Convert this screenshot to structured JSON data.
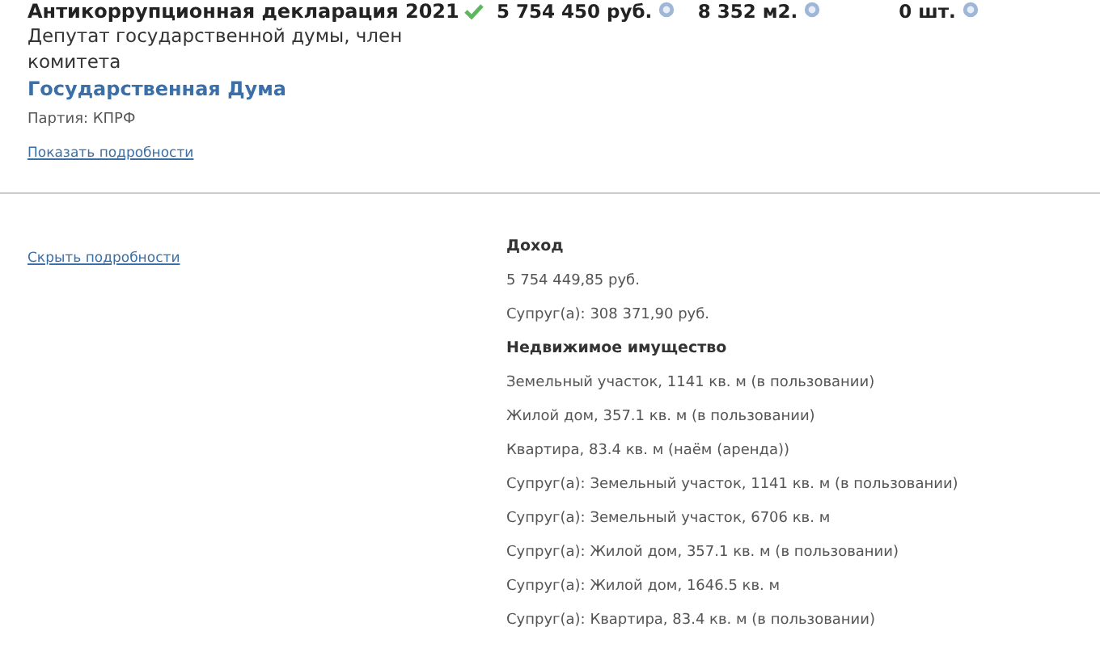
{
  "declaration": {
    "title": "Антикоррупционная декларация 2021",
    "verified": true,
    "position": "Депутат государственной думы, член комитета",
    "organization": "Государственная Дума",
    "party": "Партия: КПРФ",
    "show_details_link": "Показать подробности"
  },
  "stats": [
    {
      "value": "5 754 450 руб."
    },
    {
      "value": "8 352 м2."
    },
    {
      "value": "0 шт."
    }
  ],
  "details": {
    "hide_details_link": "Скрыть подробности",
    "sections": [
      {
        "heading": "Доход",
        "items": [
          "5 754 449,85 руб.",
          "Супруг(а): 308 371,90 руб."
        ]
      },
      {
        "heading": "Недвижимое имущество",
        "items": [
          "Земельный участок, 1141 кв. м (в пользовании)",
          "Жилой дом, 357.1 кв. м (в пользовании)",
          "Квартира, 83.4 кв. м (наём (аренда))",
          "Супруг(а): Земельный участок, 1141 кв. м (в пользовании)",
          "Супруг(а): Земельный участок, 6706 кв. м",
          "Супруг(а): Жилой дом, 357.1 кв. м (в пользовании)",
          "Супруг(а): Жилой дом, 1646.5 кв. м",
          "Супруг(а): Квартира, 83.4 кв. м (в пользовании)"
        ]
      }
    ]
  }
}
